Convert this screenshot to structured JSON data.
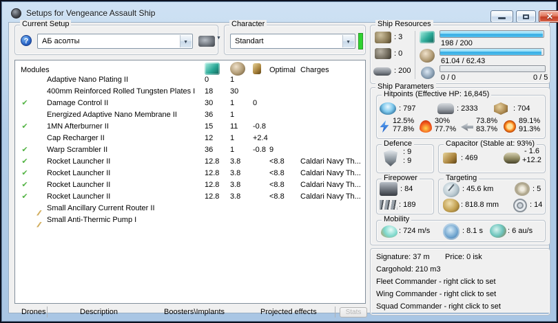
{
  "window": {
    "title": "Setups for Vengeance Assault Ship"
  },
  "colors": {
    "status_green": "#30d330",
    "bar_blue": "#2fa8e2",
    "check_green": "#54b445"
  },
  "current_setup": {
    "label": "Current Setup",
    "value": "АБ асолты"
  },
  "character": {
    "label": "Character",
    "value": "Standart"
  },
  "ship_resources": {
    "label": "Ship Resources",
    "turrets": ": 3",
    "launchers": ": 0",
    "calibration": ": 200",
    "cpu": {
      "text": "198 / 200",
      "pct": 99
    },
    "powergrid": {
      "text": "61.04 / 62.43",
      "pct": 97.8
    },
    "upgrades": {
      "left": "0 / 0",
      "right": "0 / 5",
      "pct": 0
    }
  },
  "ship_parameters": {
    "label": "Ship Parameters",
    "hitpoints": {
      "label": "Hitpoints (Effective HP: 16,845)",
      "shield": ": 797",
      "armor": ": 2333",
      "structure": ": 704",
      "resists": [
        {
          "type": "em",
          "top": "12.5%",
          "bottom": "77.8%"
        },
        {
          "type": "thermal",
          "top": "30%",
          "bottom": "77.7%"
        },
        {
          "type": "kinetic",
          "top": "73.8%",
          "bottom": "83.7%"
        },
        {
          "type": "explosive",
          "top": "89.1%",
          "bottom": "91.3%"
        }
      ]
    },
    "defence": {
      "label": "Defence",
      "top": ": 9",
      "bottom": ": 9"
    },
    "capacitor": {
      "label": "Capacitor (Stable at: 93%)",
      "amount": ": 469",
      "delta_top": "- 1.6",
      "delta_bottom": "+12.2"
    },
    "firepower": {
      "label": "Firepower",
      "volley": ": 84",
      "dps": ": 189"
    },
    "targeting": {
      "label": "Targeting",
      "range": ": 45.6 km",
      "max_targets": ": 5",
      "scan_res": ": 818.8 mm",
      "sensor_strength": ": 14"
    },
    "mobility": {
      "label": "Mobility",
      "speed": ": 724 m/s",
      "align": ": 8.1 s",
      "warp": ": 6 au/s"
    }
  },
  "info": {
    "signature": "Signature: 37 m",
    "price": "Price: 0 isk",
    "cargohold": "Cargohold: 210 m3",
    "fleet": "Fleet Commander - right click to set",
    "wing": "Wing Commander - right click to set",
    "squad": "Squad Commander - right click to set"
  },
  "modules": {
    "header": {
      "name": "Modules",
      "optimal": "Optimal",
      "charges": "Charges"
    },
    "rows": [
      {
        "checked": false,
        "icon": "plating",
        "name": "Adaptive Nano Plating II",
        "cpu": "0",
        "pg": "1",
        "cap": "",
        "optimal": "",
        "charges": ""
      },
      {
        "checked": false,
        "icon": "plate400",
        "name": "400mm Reinforced Rolled Tungsten Plates I",
        "cpu": "18",
        "pg": "30",
        "cap": "",
        "optimal": "",
        "charges": ""
      },
      {
        "checked": true,
        "icon": "dcu",
        "name": "Damage Control II",
        "cpu": "30",
        "pg": "1",
        "cap": "0",
        "optimal": "",
        "charges": ""
      },
      {
        "checked": false,
        "icon": "membrane",
        "name": "Energized Adaptive Nano Membrane II",
        "cpu": "36",
        "pg": "1",
        "cap": "",
        "optimal": "",
        "charges": ""
      },
      {
        "checked": true,
        "icon": "ab",
        "name": "1MN Afterburner II",
        "cpu": "15",
        "pg": "11",
        "cap": "-0.8",
        "optimal": "",
        "charges": ""
      },
      {
        "checked": false,
        "icon": "capre",
        "name": "Cap Recharger II",
        "cpu": "12",
        "pg": "1",
        "cap": "+2.4",
        "optimal": "",
        "charges": ""
      },
      {
        "checked": true,
        "icon": "scram",
        "name": "Warp Scrambler II",
        "cpu": "36",
        "pg": "1",
        "cap": "-0.8",
        "optimal": "9",
        "charges": ""
      },
      {
        "checked": true,
        "icon": "rocket",
        "name": "Rocket Launcher II",
        "cpu": "12.8",
        "pg": "3.8",
        "cap": "",
        "optimal": "<8.8",
        "charges": "Caldari Navy Th..."
      },
      {
        "checked": true,
        "icon": "rocket",
        "name": "Rocket Launcher II",
        "cpu": "12.8",
        "pg": "3.8",
        "cap": "",
        "optimal": "<8.8",
        "charges": "Caldari Navy Th..."
      },
      {
        "checked": true,
        "icon": "rocket",
        "name": "Rocket Launcher II",
        "cpu": "12.8",
        "pg": "3.8",
        "cap": "",
        "optimal": "<8.8",
        "charges": "Caldari Navy Th..."
      },
      {
        "checked": true,
        "icon": "rocket",
        "name": "Rocket Launcher II",
        "cpu": "12.8",
        "pg": "3.8",
        "cap": "",
        "optimal": "<8.8",
        "charges": "Caldari Navy Th..."
      },
      {
        "checked": false,
        "icon": "rig",
        "name": "Small Ancillary Current Router II",
        "cpu": "",
        "pg": "",
        "cap": "",
        "optimal": "",
        "charges": ""
      },
      {
        "checked": false,
        "icon": "rig",
        "name": "Small Anti-Thermic Pump I",
        "cpu": "",
        "pg": "",
        "cap": "",
        "optimal": "",
        "charges": ""
      }
    ]
  },
  "tabs": [
    "Drones",
    "Description",
    "Boosters\\Implants",
    "Projected effects"
  ],
  "stats_button": "Stats"
}
